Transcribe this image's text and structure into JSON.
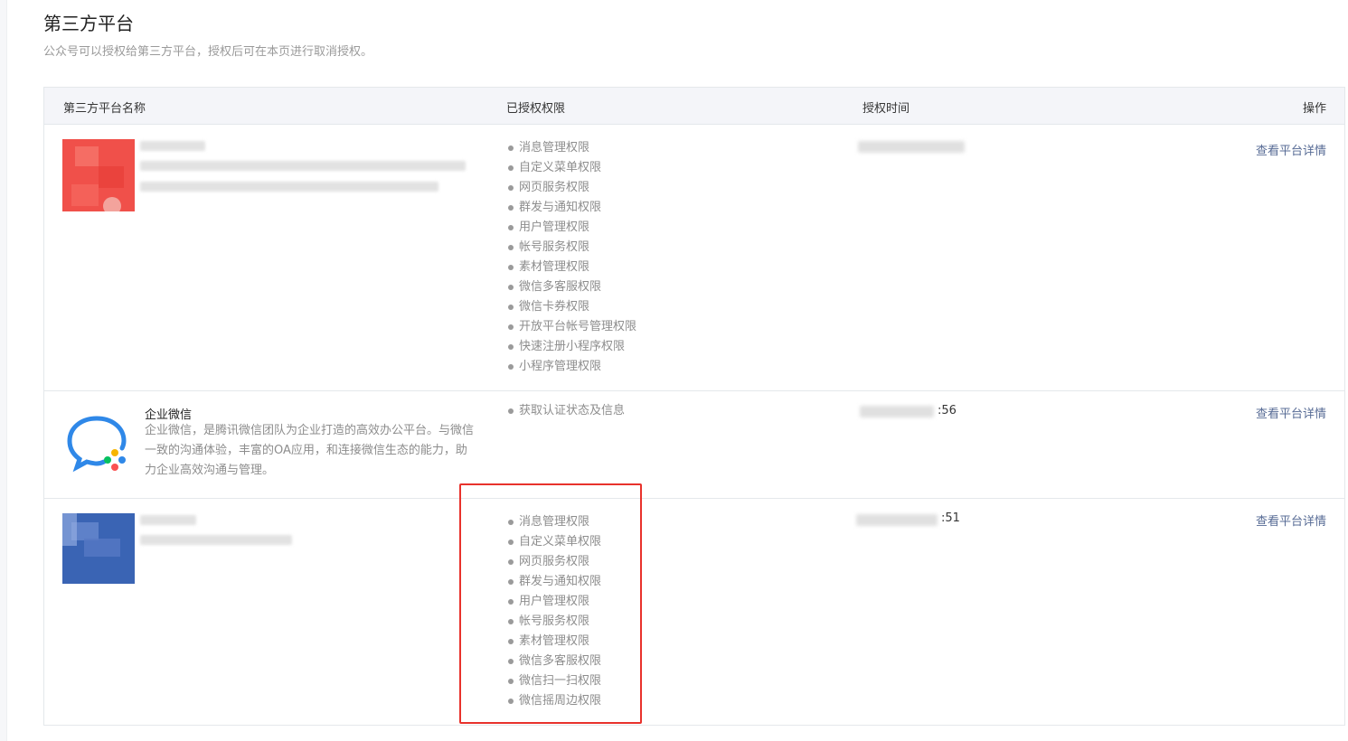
{
  "page": {
    "title": "第三方平台",
    "description": "公众号可以授权给第三方平台，授权后可在本页进行取消授权。"
  },
  "table": {
    "headers": {
      "name": "第三方平台名称",
      "permissions": "已授权权限",
      "time": "授权时间",
      "operation": "操作"
    },
    "rows": [
      {
        "name": "",
        "description": "",
        "logo_color": "#f0504a",
        "time_suffix": "",
        "operation": "查看平台详情",
        "permissions": [
          "消息管理权限",
          "自定义菜单权限",
          "网页服务权限",
          "群发与通知权限",
          "用户管理权限",
          "帐号服务权限",
          "素材管理权限",
          "微信多客服权限",
          "微信卡券权限",
          "开放平台帐号管理权限",
          "快速注册小程序权限",
          "小程序管理权限"
        ]
      },
      {
        "name": "企业微信",
        "description": "企业微信，是腾讯微信团队为企业打造的高效办公平台。与微信一致的沟通体验，丰富的OA应用，和连接微信生态的能力，助力企业高效沟通与管理。",
        "logo_icon": "wecom-chat-bubble-icon",
        "time_suffix": ":56",
        "operation": "查看平台详情",
        "permissions": [
          "获取认证状态及信息"
        ]
      },
      {
        "name": "",
        "description": "",
        "logo_color": "#3a64b4",
        "time_suffix": ":51",
        "operation": "查看平台详情",
        "permissions": [
          "消息管理权限",
          "自定义菜单权限",
          "网页服务权限",
          "群发与通知权限",
          "用户管理权限",
          "帐号服务权限",
          "素材管理权限",
          "微信多客服权限",
          "微信扫一扫权限",
          "微信摇周边权限"
        ]
      }
    ]
  },
  "colors": {
    "link": "#576b95",
    "highlight": "#e8322c",
    "header_bg": "#f4f5f9"
  }
}
